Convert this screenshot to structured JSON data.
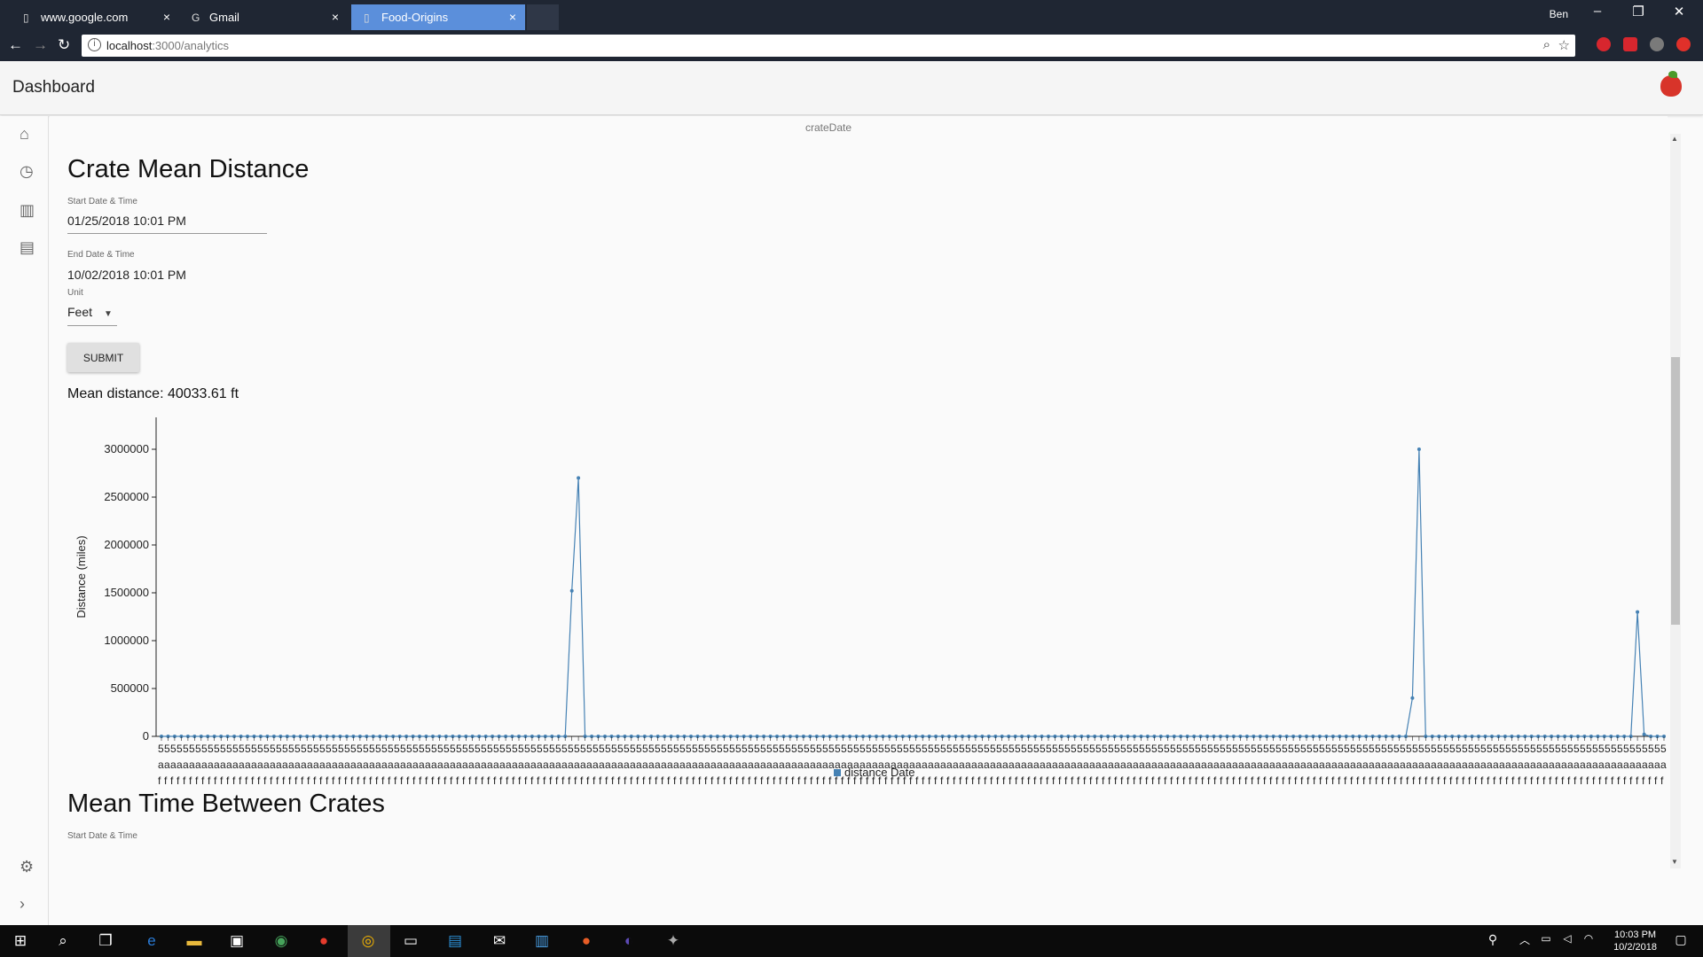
{
  "browser": {
    "tabs": [
      {
        "title": "www.google.com",
        "close": "×"
      },
      {
        "title": "Gmail",
        "close": "×"
      },
      {
        "title": "Food-Origins",
        "close": "×"
      }
    ],
    "user": "Ben",
    "url_host": "localhost",
    "url_path": ":3000/analytics"
  },
  "app": {
    "title": "Dashboard"
  },
  "section1": {
    "stub_legend": "crateDate",
    "title": "Crate Mean Distance",
    "start_label": "Start Date & Time",
    "start_value": "01/25/2018 10:01 PM",
    "end_label": "End Date & Time",
    "end_value": "10/02/2018 10:01 PM",
    "unit_label": "Unit",
    "unit_value": "Feet",
    "submit_label": "SUBMIT",
    "mean_text": "Mean distance: 40033.61 ft"
  },
  "section2": {
    "title": "Mean Time Between Crates",
    "start_label": "Start Date & Time"
  },
  "taskbar": {
    "time": "10:03 PM",
    "date": "10/2/2018"
  },
  "chart_data": {
    "type": "line",
    "ylabel": "Distance (miles)",
    "legend": "distance Date",
    "legend_position": "bottom-center",
    "ylim": [
      0,
      3000000
    ],
    "yticks": [
      0,
      500000,
      1000000,
      1500000,
      2000000,
      2500000,
      3000000
    ],
    "tick_label_rows": [
      "5",
      "a",
      "f"
    ],
    "series_color": "#4682b4",
    "point_count": 228,
    "spikes": [
      {
        "index": 62,
        "value": 1520000
      },
      {
        "index": 63,
        "value": 2700000
      },
      {
        "index": 189,
        "value": 400000
      },
      {
        "index": 190,
        "value": 3000000
      },
      {
        "index": 223,
        "value": 1300000
      },
      {
        "index": 224,
        "value": 20000
      }
    ],
    "baseline_value": 0
  }
}
